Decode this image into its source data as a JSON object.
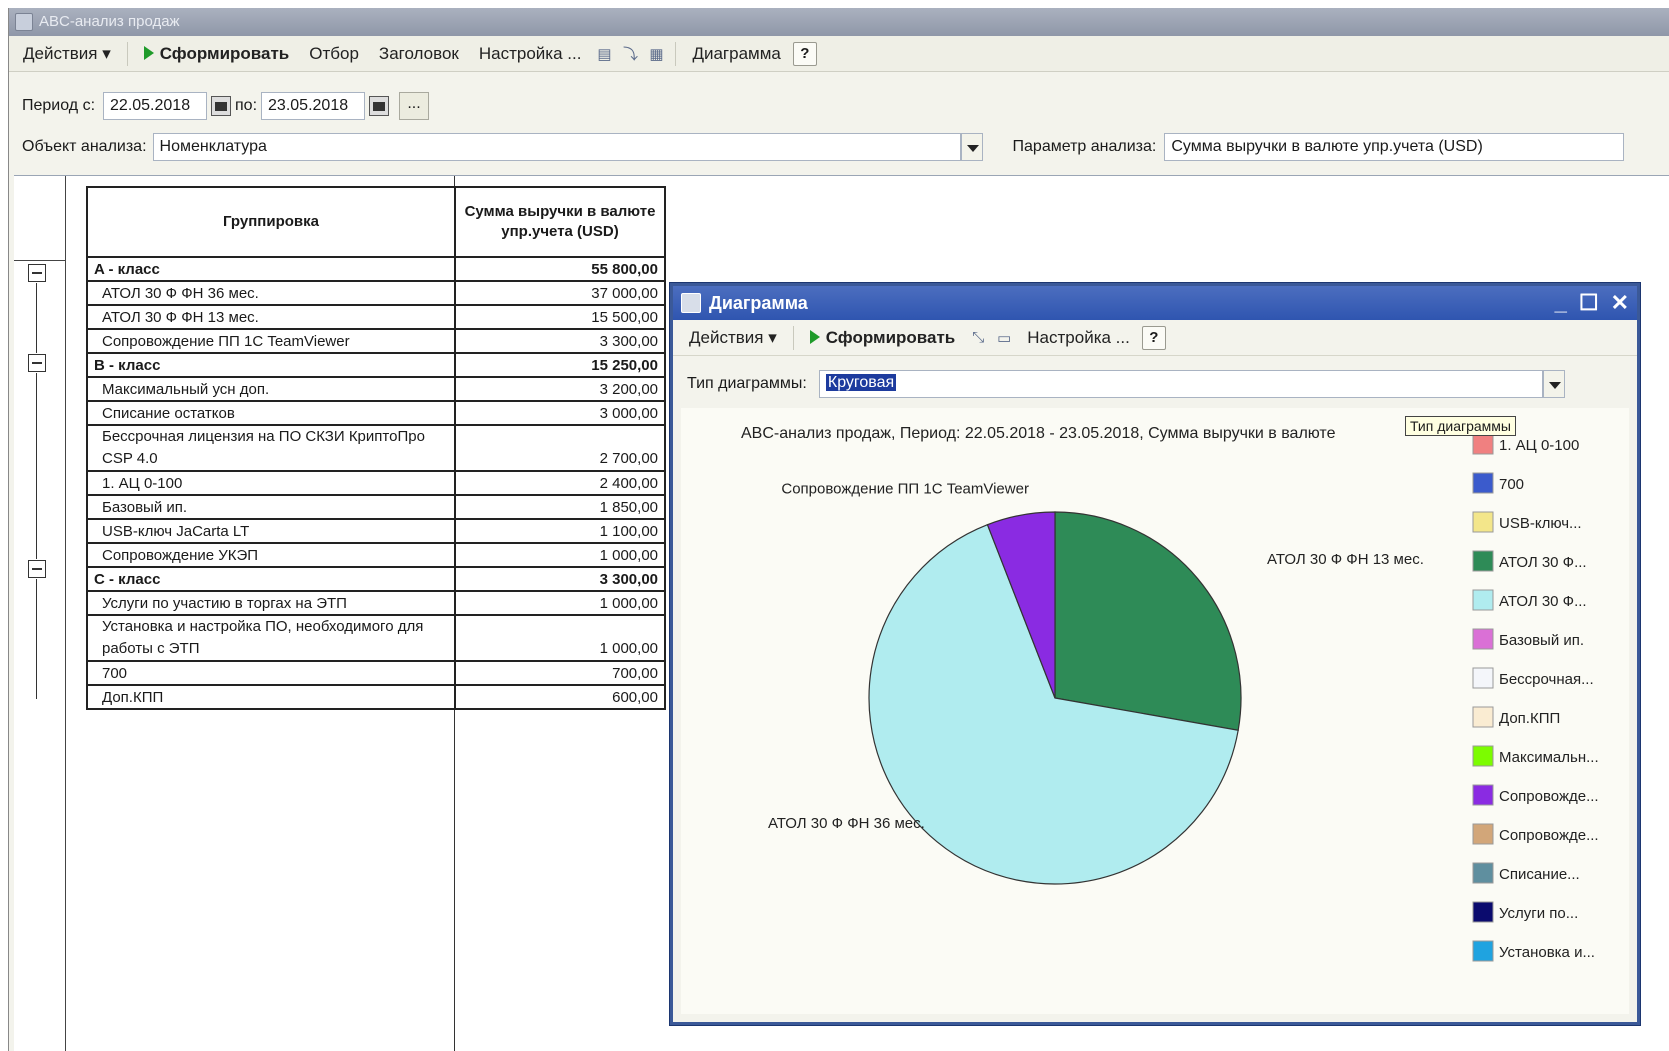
{
  "main_window": {
    "title": "ABC-анализ продаж",
    "toolbar": {
      "actions": "Действия ▾",
      "generate": "Сформировать",
      "filter": "Отбор",
      "header": "Заголовок",
      "settings": "Настройка ...",
      "chart": "Диаграмма",
      "help": "?"
    },
    "period": {
      "label_from": "Период с:",
      "date_from": "22.05.2018",
      "label_to": "по:",
      "date_to": "23.05.2018",
      "dots": "..."
    },
    "analysis_object": {
      "label": "Объект анализа:",
      "value": "Номенклатура"
    },
    "analysis_param": {
      "label": "Параметр анализа:",
      "value": "Сумма выручки в валюте упр.учета (USD)"
    }
  },
  "report": {
    "col_group": "Группировка",
    "col_amount": "Сумма выручки в валюте упр.учета (USD)",
    "rows": [
      {
        "name": "A - класс",
        "amount": "55 800,00",
        "class": true
      },
      {
        "name": "АТОЛ 30 Ф ФН 36 мес.",
        "amount": "37 000,00"
      },
      {
        "name": "АТОЛ 30 Ф ФН 13 мес.",
        "amount": "15 500,00"
      },
      {
        "name": "Сопровождение ПП 1С TeamViewer",
        "amount": "3 300,00"
      },
      {
        "name": "B - класс",
        "amount": "15 250,00",
        "class": true
      },
      {
        "name": "Максимальный усн доп.",
        "amount": "3 200,00"
      },
      {
        "name": "Списание остатков",
        "amount": "3 000,00"
      },
      {
        "name": "Бессрочная лицензия на ПО СКЗИ КриптоПро CSP 4.0",
        "amount": "2 700,00",
        "tall": true
      },
      {
        "name": "1. АЦ 0-100",
        "amount": "2 400,00"
      },
      {
        "name": "Базовый ип.",
        "amount": "1 850,00"
      },
      {
        "name": "USB-ключ JaCarta LT",
        "amount": "1 100,00"
      },
      {
        "name": "Сопровождение УКЭП",
        "amount": "1 000,00"
      },
      {
        "name": "C - класс",
        "amount": "3 300,00",
        "class": true
      },
      {
        "name": "Услуги по участию в торгах на ЭТП",
        "amount": "1 000,00"
      },
      {
        "name": "Установка и настройка ПО, необходимого для работы с ЭТП",
        "amount": "1 000,00",
        "tall": true
      },
      {
        "name": "700",
        "amount": "700,00"
      },
      {
        "name": "Доп.КПП",
        "amount": "600,00"
      }
    ]
  },
  "chart_window": {
    "title": "Диаграмма",
    "toolbar": {
      "actions": "Действия ▾",
      "generate": "Сформировать",
      "settings": "Настройка ...",
      "help": "?"
    },
    "chart_type_label": "Тип диаграммы:",
    "chart_type_value": "Круговая",
    "tooltip": "Тип диаграммы"
  },
  "chart_data": {
    "type": "pie",
    "title": "ABC-анализ продаж, Период: 22.05.2018 - 23.05.2018, Сумма выручки в валюте",
    "slices": [
      {
        "label": "АТОЛ 30 Ф ФН 13 мес.",
        "value": 15500,
        "color": "#2e8b57"
      },
      {
        "label": "АТОЛ 30 Ф ФН 36 мес.",
        "value": 37000,
        "color": "#b0ecef"
      },
      {
        "label": "Сопровождение ПП 1С TeamViewer",
        "value": 3300,
        "color": "#8a2be2"
      }
    ],
    "legend": [
      {
        "label": "1. АЦ 0-100",
        "color": "#f08080"
      },
      {
        "label": "700",
        "color": "#3b5bcc"
      },
      {
        "label": "USB-ключ...",
        "color": "#f3e68a"
      },
      {
        "label": "АТОЛ 30 Ф...",
        "color": "#2e8b57"
      },
      {
        "label": "АТОЛ 30 Ф...",
        "color": "#b0ecef"
      },
      {
        "label": "Базовый ип.",
        "color": "#da70d6"
      },
      {
        "label": "Бессрочная...",
        "color": "#f4f6fa"
      },
      {
        "label": "Доп.КПП",
        "color": "#faecd2"
      },
      {
        "label": "Максимальн...",
        "color": "#7cfc00"
      },
      {
        "label": "Сопровожде...",
        "color": "#8a2be2"
      },
      {
        "label": "Сопровожде...",
        "color": "#d2a679"
      },
      {
        "label": "Списание...",
        "color": "#5f8f9f"
      },
      {
        "label": "Услуги по...",
        "color": "#0b0b6e"
      },
      {
        "label": "Установка и...",
        "color": "#1fa3e0"
      }
    ],
    "legend_position": "right"
  }
}
